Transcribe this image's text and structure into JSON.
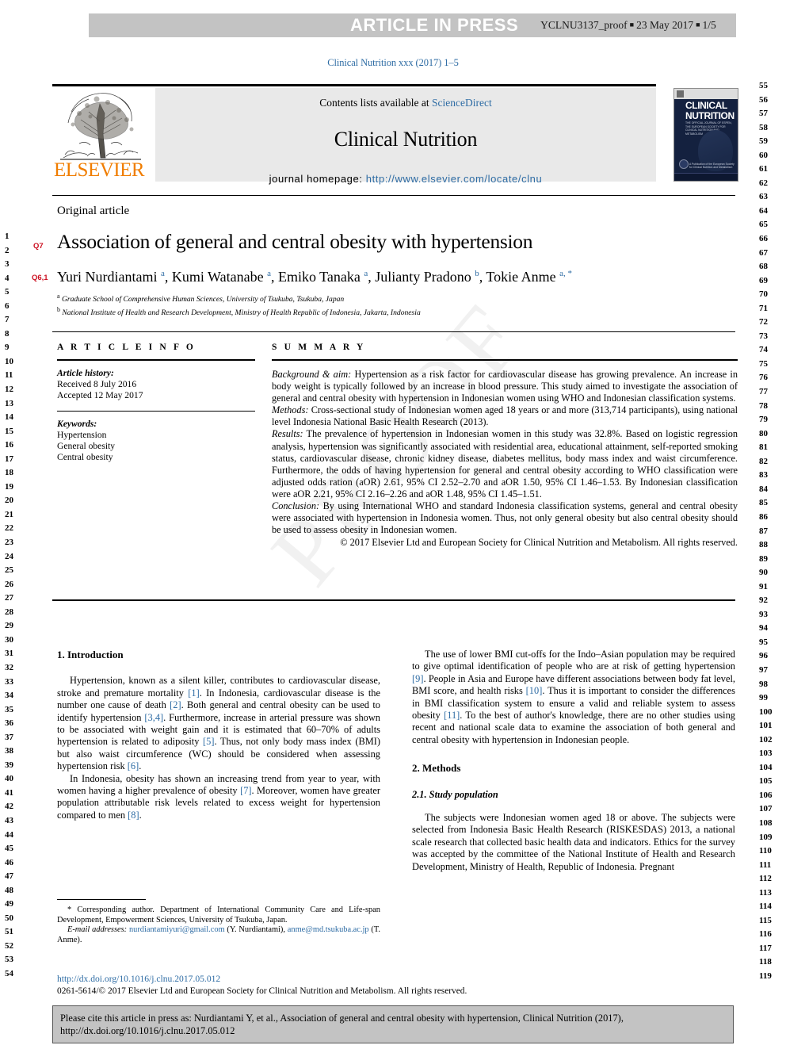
{
  "press_banner": {
    "title": "ARTICLE IN PRESS",
    "proof_id": "YCLNU3137_proof",
    "sep": "■",
    "date": "23 May 2017",
    "page": "1/5"
  },
  "journal_line": "Clinical Nutrition xxx (2017) 1–5",
  "masthead": {
    "contents_prefix": "Contents lists available at ",
    "sciencedirect": "ScienceDirect",
    "journal_name": "Clinical Nutrition",
    "homepage_label": "journal homepage: ",
    "homepage_url": "http://www.elsevier.com/locate/clnu",
    "publisher": "ELSEVIER"
  },
  "cover": {
    "line1": "CLINICAL",
    "line2": "NUTRITION",
    "subtitle": "THE OFFICIAL JOURNAL OF ESPEN, THE EUROPEAN SOCIETY FOR CLINICAL NUTRITION AND METABOLISM",
    "footer": "A Publication of the European Society for Clinical Nutrition and Metabolism"
  },
  "article": {
    "type_label": "Original article",
    "q_title_tag": "Q7",
    "q_authors_tag": "Q6,1",
    "title": "Association of general and central obesity with hypertension",
    "authors_html": "Yuri Nurdiantami <sup>a</sup>, Kumi Watanabe <sup>a</sup>, Emiko Tanaka <sup>a</sup>, Julianty Pradono <sup>b</sup>, Tokie Anme <sup>a, *</sup>",
    "affiliations": [
      "Graduate School of Comprehensive Human Sciences, University of Tsukuba, Tsukuba, Japan",
      "National Institute of Health and Research Development, Ministry of Health Republic of Indonesia, Jakarta, Indonesia"
    ]
  },
  "article_info": {
    "heading": "A R T I C L E   I N F O",
    "history_label": "Article history:",
    "received": "Received 8 July 2016",
    "accepted": "Accepted 12 May 2017",
    "keywords_label": "Keywords:",
    "keywords": [
      "Hypertension",
      "General obesity",
      "Central obesity"
    ]
  },
  "summary": {
    "heading": "S U M M A R Y",
    "background_label": "Background & aim:",
    "background_text": " Hypertension as a risk factor for cardiovascular disease has growing prevalence. An increase in body weight is typically followed by an increase in blood pressure. This study aimed to investigate the association of general and central obesity with hypertension in Indonesian women using WHO and Indonesian classification systems.",
    "methods_label": "Methods:",
    "methods_text": " Cross-sectional study of Indonesian women aged 18 years or and more (313,714 participants), using national level Indonesia National Basic Health Research (2013).",
    "results_label": "Results:",
    "results_text": " The prevalence of hypertension in Indonesian women in this study was 32.8%. Based on logistic regression analysis, hypertension was significantly associated with residential area, educational attainment, self-reported smoking status, cardiovascular disease, chronic kidney disease, diabetes mellitus, body mass index and waist circumference. Furthermore, the odds of having hypertension for general and central obesity according to WHO classification were adjusted odds ration (aOR) 2.61, 95% CI 2.52–2.70 and aOR 1.50, 95% CI 1.46–1.53. By Indonesian classification were aOR 2.21, 95% CI 2.16–2.26 and aOR 1.48, 95% CI 1.45–1.51.",
    "conclusion_label": "Conclusion:",
    "conclusion_text": " By using International WHO and standard Indonesia classification systems, general and central obesity were associated with hypertension in Indonesia women. Thus, not only general obesity but also central obesity should be used to assess obesity in Indonesian women.",
    "copyright": "© 2017 Elsevier Ltd and European Society for Clinical Nutrition and Metabolism. All rights reserved."
  },
  "body": {
    "intro_heading": "1. Introduction",
    "intro_p1_a": "Hypertension, known as a silent killer, contributes to cardiovascular disease, stroke and premature mortality ",
    "intro_r1": "[1]",
    "intro_p1_b": ". In Indonesia, cardiovascular disease is the number one cause of death ",
    "intro_r2": "[2]",
    "intro_p1_c": ". Both general and central obesity can be used to identify hypertension ",
    "intro_r3": "[3,4]",
    "intro_p1_d": ". Furthermore, increase in arterial pressure was shown to be associated with weight gain and it is estimated that 60–70% of adults hypertension is related to adiposity ",
    "intro_r5": "[5]",
    "intro_p1_e": ". Thus, not only body mass index (BMI) but also waist circumference (WC) should be considered when assessing hypertension risk ",
    "intro_r6": "[6]",
    "intro_p1_f": ".",
    "intro_p2_a": "In Indonesia, obesity has shown an increasing trend from year to year, with women having a higher prevalence of obesity ",
    "intro_r7": "[7]",
    "intro_p2_b": ". Moreover, women have greater population attributable risk levels related to excess weight for hypertension compared to men ",
    "intro_r8": "[8]",
    "intro_p2_c": ".",
    "right_p1_a": "The use of lower BMI cut-offs for the Indo–Asian population may be required to give optimal identification of people who are at risk of getting hypertension ",
    "right_r9": "[9]",
    "right_p1_b": ". People in Asia and Europe have different associations between body fat level, BMI score, and health risks ",
    "right_r10": "[10]",
    "right_p1_c": ". Thus it is important to consider the differences in BMI classification system to ensure a valid and reliable system to assess obesity ",
    "right_r11": "[11]",
    "right_p1_d": ". To the best of author's knowledge, there are no other studies using recent and national scale data to examine the association of both general and central obesity with hypertension in Indonesian people.",
    "methods_heading": "2. Methods",
    "study_pop_heading": "2.1. Study population",
    "study_pop_text": "The subjects were Indonesian women aged 18 or above. The subjects were selected from Indonesia Basic Health Research (RISKESDAS) 2013, a national scale research that collected basic health data and indicators. Ethics for the survey was accepted by the committee of the National Institute of Health and Research Development, Ministry of Health, Republic of Indonesia. Pregnant"
  },
  "footnotes": {
    "corr_marker": "*",
    "corr_text": " Corresponding author. Department of International Community Care and Life-span Development, Empowerment Sciences, University of Tsukuba, Japan.",
    "email_label": "E-mail addresses:",
    "email1": "nurdiantamiyuri@gmail.com",
    "email1_owner": " (Y. Nurdiantami), ",
    "email2": "anme@md.tsukuba.ac.jp",
    "email2_owner": " (T. Anme).",
    "doi": "http://dx.doi.org/10.1016/j.clnu.2017.05.012",
    "issn_copyright": "0261-5614/© 2017 Elsevier Ltd and European Society for Clinical Nutrition and Metabolism. All rights reserved."
  },
  "cite_box": {
    "line1": "Please cite this article in press as: Nurdiantami Y, et al., Association of general and central obesity with hypertension, Clinical Nutrition (2017),",
    "line2": "http://dx.doi.org/10.1016/j.clnu.2017.05.012"
  },
  "watermark": "PROOF",
  "line_numbers": {
    "left_start": 1,
    "left_end": 54,
    "right_start": 55,
    "right_end": 119
  },
  "colors": {
    "link": "#2e6ca4",
    "banner": "#c3c3c3",
    "elsevier_orange": "#f07d00",
    "query_red": "#cc1122"
  }
}
